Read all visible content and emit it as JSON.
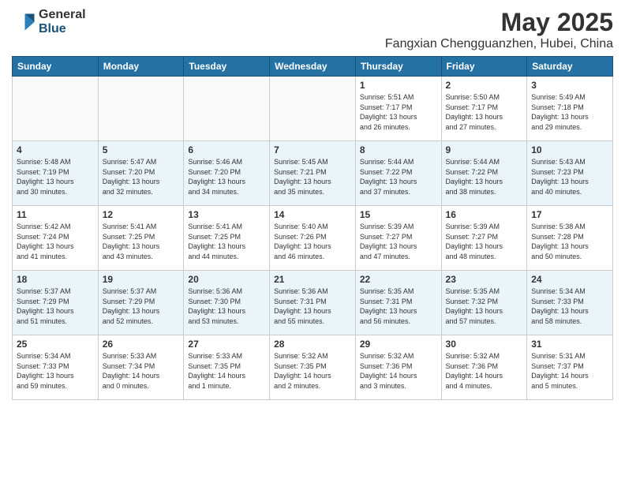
{
  "logo": {
    "general": "General",
    "blue": "Blue"
  },
  "title": "May 2025",
  "location": "Fangxian Chengguanzhen, Hubei, China",
  "weekdays": [
    "Sunday",
    "Monday",
    "Tuesday",
    "Wednesday",
    "Thursday",
    "Friday",
    "Saturday"
  ],
  "weeks": [
    [
      {
        "day": "",
        "info": ""
      },
      {
        "day": "",
        "info": ""
      },
      {
        "day": "",
        "info": ""
      },
      {
        "day": "",
        "info": ""
      },
      {
        "day": "1",
        "info": "Sunrise: 5:51 AM\nSunset: 7:17 PM\nDaylight: 13 hours\nand 26 minutes."
      },
      {
        "day": "2",
        "info": "Sunrise: 5:50 AM\nSunset: 7:17 PM\nDaylight: 13 hours\nand 27 minutes."
      },
      {
        "day": "3",
        "info": "Sunrise: 5:49 AM\nSunset: 7:18 PM\nDaylight: 13 hours\nand 29 minutes."
      }
    ],
    [
      {
        "day": "4",
        "info": "Sunrise: 5:48 AM\nSunset: 7:19 PM\nDaylight: 13 hours\nand 30 minutes."
      },
      {
        "day": "5",
        "info": "Sunrise: 5:47 AM\nSunset: 7:20 PM\nDaylight: 13 hours\nand 32 minutes."
      },
      {
        "day": "6",
        "info": "Sunrise: 5:46 AM\nSunset: 7:20 PM\nDaylight: 13 hours\nand 34 minutes."
      },
      {
        "day": "7",
        "info": "Sunrise: 5:45 AM\nSunset: 7:21 PM\nDaylight: 13 hours\nand 35 minutes."
      },
      {
        "day": "8",
        "info": "Sunrise: 5:44 AM\nSunset: 7:22 PM\nDaylight: 13 hours\nand 37 minutes."
      },
      {
        "day": "9",
        "info": "Sunrise: 5:44 AM\nSunset: 7:22 PM\nDaylight: 13 hours\nand 38 minutes."
      },
      {
        "day": "10",
        "info": "Sunrise: 5:43 AM\nSunset: 7:23 PM\nDaylight: 13 hours\nand 40 minutes."
      }
    ],
    [
      {
        "day": "11",
        "info": "Sunrise: 5:42 AM\nSunset: 7:24 PM\nDaylight: 13 hours\nand 41 minutes."
      },
      {
        "day": "12",
        "info": "Sunrise: 5:41 AM\nSunset: 7:25 PM\nDaylight: 13 hours\nand 43 minutes."
      },
      {
        "day": "13",
        "info": "Sunrise: 5:41 AM\nSunset: 7:25 PM\nDaylight: 13 hours\nand 44 minutes."
      },
      {
        "day": "14",
        "info": "Sunrise: 5:40 AM\nSunset: 7:26 PM\nDaylight: 13 hours\nand 46 minutes."
      },
      {
        "day": "15",
        "info": "Sunrise: 5:39 AM\nSunset: 7:27 PM\nDaylight: 13 hours\nand 47 minutes."
      },
      {
        "day": "16",
        "info": "Sunrise: 5:39 AM\nSunset: 7:27 PM\nDaylight: 13 hours\nand 48 minutes."
      },
      {
        "day": "17",
        "info": "Sunrise: 5:38 AM\nSunset: 7:28 PM\nDaylight: 13 hours\nand 50 minutes."
      }
    ],
    [
      {
        "day": "18",
        "info": "Sunrise: 5:37 AM\nSunset: 7:29 PM\nDaylight: 13 hours\nand 51 minutes."
      },
      {
        "day": "19",
        "info": "Sunrise: 5:37 AM\nSunset: 7:29 PM\nDaylight: 13 hours\nand 52 minutes."
      },
      {
        "day": "20",
        "info": "Sunrise: 5:36 AM\nSunset: 7:30 PM\nDaylight: 13 hours\nand 53 minutes."
      },
      {
        "day": "21",
        "info": "Sunrise: 5:36 AM\nSunset: 7:31 PM\nDaylight: 13 hours\nand 55 minutes."
      },
      {
        "day": "22",
        "info": "Sunrise: 5:35 AM\nSunset: 7:31 PM\nDaylight: 13 hours\nand 56 minutes."
      },
      {
        "day": "23",
        "info": "Sunrise: 5:35 AM\nSunset: 7:32 PM\nDaylight: 13 hours\nand 57 minutes."
      },
      {
        "day": "24",
        "info": "Sunrise: 5:34 AM\nSunset: 7:33 PM\nDaylight: 13 hours\nand 58 minutes."
      }
    ],
    [
      {
        "day": "25",
        "info": "Sunrise: 5:34 AM\nSunset: 7:33 PM\nDaylight: 13 hours\nand 59 minutes."
      },
      {
        "day": "26",
        "info": "Sunrise: 5:33 AM\nSunset: 7:34 PM\nDaylight: 14 hours\nand 0 minutes."
      },
      {
        "day": "27",
        "info": "Sunrise: 5:33 AM\nSunset: 7:35 PM\nDaylight: 14 hours\nand 1 minute."
      },
      {
        "day": "28",
        "info": "Sunrise: 5:32 AM\nSunset: 7:35 PM\nDaylight: 14 hours\nand 2 minutes."
      },
      {
        "day": "29",
        "info": "Sunrise: 5:32 AM\nSunset: 7:36 PM\nDaylight: 14 hours\nand 3 minutes."
      },
      {
        "day": "30",
        "info": "Sunrise: 5:32 AM\nSunset: 7:36 PM\nDaylight: 14 hours\nand 4 minutes."
      },
      {
        "day": "31",
        "info": "Sunrise: 5:31 AM\nSunset: 7:37 PM\nDaylight: 14 hours\nand 5 minutes."
      }
    ]
  ]
}
